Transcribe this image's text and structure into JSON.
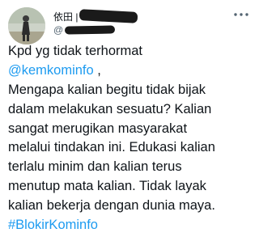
{
  "tweet": {
    "author": {
      "display_name": "依田 | ",
      "handle_prefix": "@"
    },
    "lines": [
      {
        "text": "Kpd yg tidak terhormat"
      },
      {
        "mention": "@kemkominfo",
        "after": " ,"
      },
      {
        "text": "Mengapa kalian begitu tidak bijak"
      },
      {
        "text": "dalam melakukan sesuatu? Kalian"
      },
      {
        "text": "sangat merugikan masyarakat"
      },
      {
        "text": "melalui tindakan ini. Edukasi kalian"
      },
      {
        "text": "terlalu minim dan kalian terus"
      },
      {
        "text": "menutup mata kalian. Tidak layak"
      },
      {
        "text": "kalian bekerja dengan dunia maya."
      },
      {
        "hashtag": "#BlokirKominfo"
      }
    ],
    "more_icon": "more-horizontal-icon"
  },
  "colors": {
    "text": "#0f1419",
    "secondary": "#536471",
    "link": "#1d9bf0",
    "background": "#ffffff"
  }
}
